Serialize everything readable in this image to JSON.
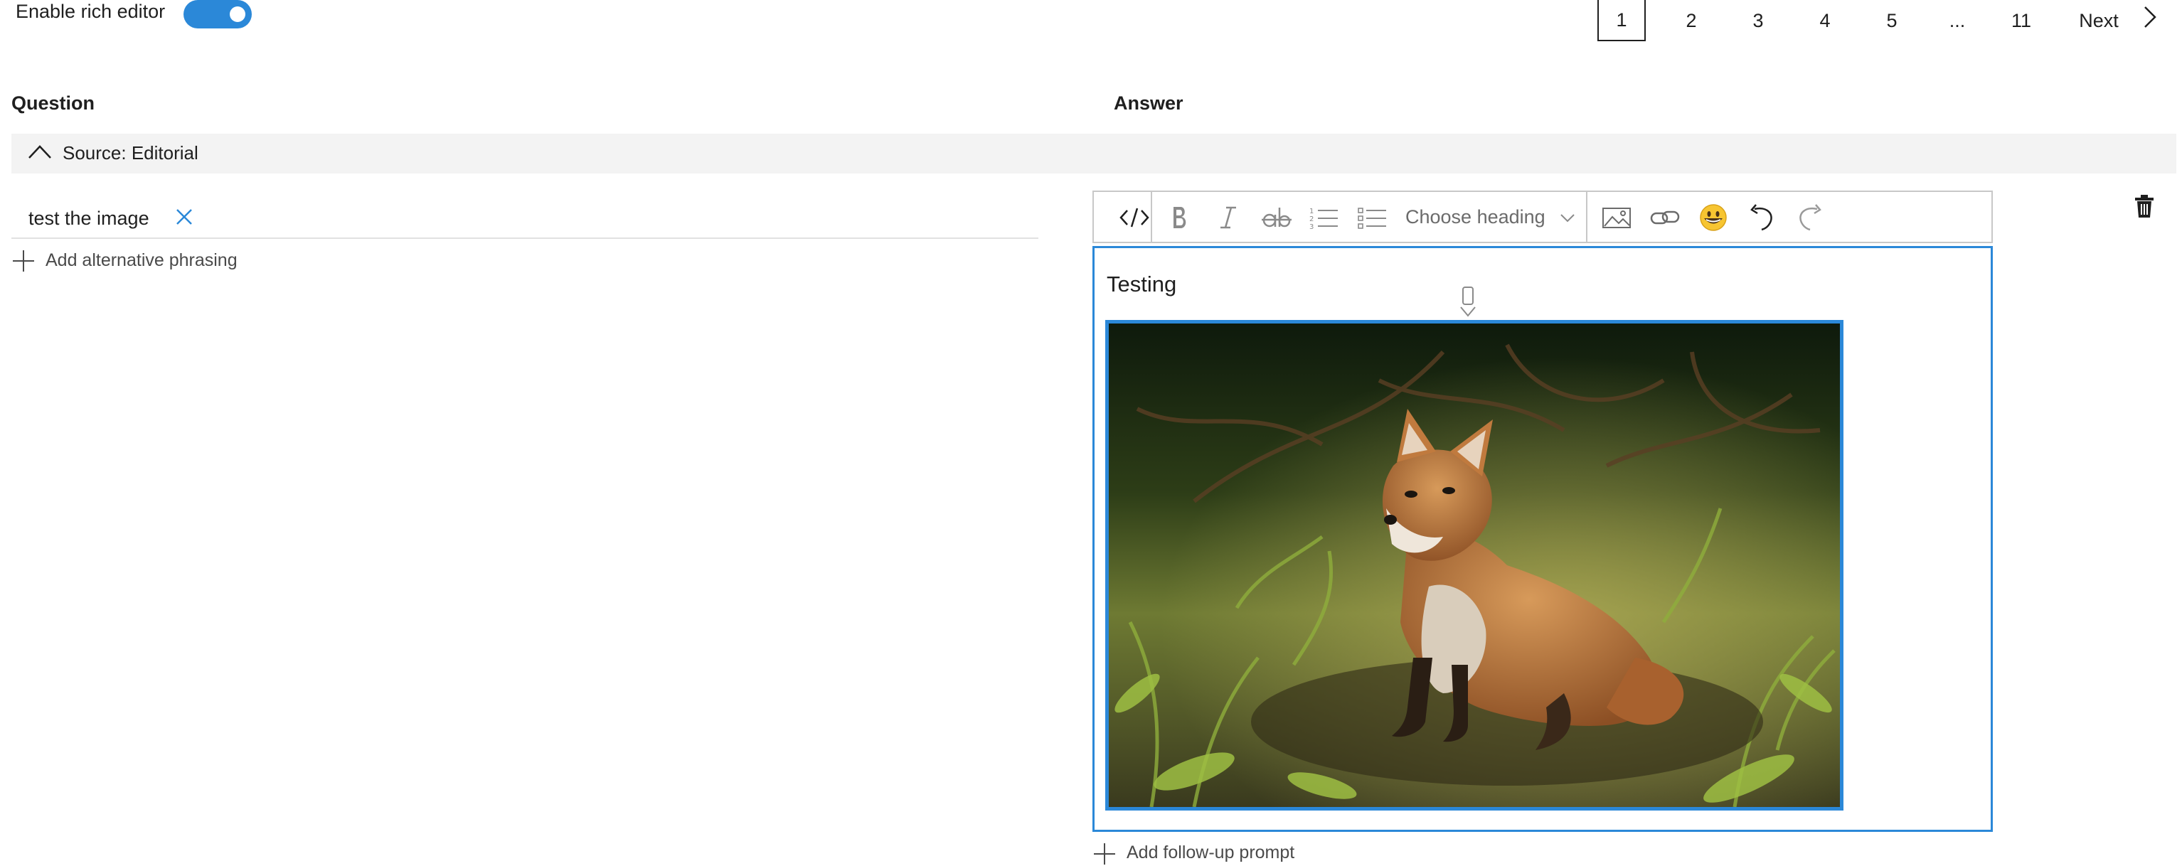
{
  "header": {
    "rich_editor_label": "Enable rich editor",
    "rich_editor_enabled": true
  },
  "pagination": {
    "pages": [
      "1",
      "2",
      "3",
      "4",
      "5",
      "...",
      "11"
    ],
    "current": "1",
    "next_label": "Next"
  },
  "columns": {
    "question": "Question",
    "answer": "Answer"
  },
  "source": {
    "label": "Source: Editorial"
  },
  "question": {
    "text": "test the image",
    "add_alternative_label": "Add alternative phrasing"
  },
  "toolbar": {
    "heading_placeholder": "Choose heading",
    "icons": [
      "code-view-icon",
      "bold-icon",
      "italic-icon",
      "strikethrough-icon",
      "numbered-list-icon",
      "bulleted-list-icon",
      "image-icon",
      "link-icon",
      "emoji-icon",
      "undo-icon",
      "redo-icon"
    ]
  },
  "answer": {
    "text": "Testing",
    "add_followup_label": "Add follow-up prompt"
  },
  "colors": {
    "accent": "#2b88d8",
    "source_bar": "#f3f3f3",
    "border": "#c8c8c8"
  }
}
